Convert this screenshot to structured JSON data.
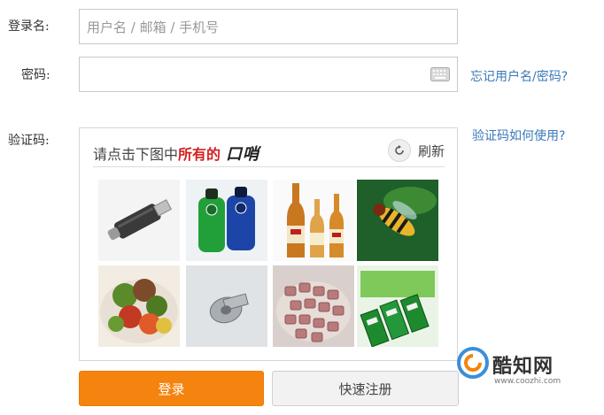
{
  "form": {
    "username_label": "登录名:",
    "username_placeholder": "用户名 / 邮箱 / 手机号",
    "password_label": "密码:",
    "forgot_link": "忘记用户名/密码?",
    "captcha_label": "验证码:",
    "captcha_help_link": "验证码如何使用?"
  },
  "captcha": {
    "prompt_plain": "请点击下图中",
    "prompt_highlight": "所有的",
    "target_word": "口哨",
    "refresh_label": "刷新",
    "tiles": [
      {
        "name": "usb-drive-image",
        "row": 1,
        "col": 1
      },
      {
        "name": "colored-bottles-image",
        "row": 1,
        "col": 2
      },
      {
        "name": "beer-bottles-image",
        "row": 1,
        "col": 3
      },
      {
        "name": "hoverfly-insect-image",
        "row": 1,
        "col": 4
      },
      {
        "name": "salad-image",
        "row": 2,
        "col": 1
      },
      {
        "name": "whistle-image",
        "row": 2,
        "col": 2
      },
      {
        "name": "candy-sugar-image",
        "row": 2,
        "col": 3
      },
      {
        "name": "green-whistles-image",
        "row": 2,
        "col": 4
      }
    ]
  },
  "buttons": {
    "login_label": "登录",
    "register_label": "快速注册"
  },
  "watermark": {
    "brand": "酷知网",
    "url": "www.coozhi.com"
  },
  "colors": {
    "accent_orange": "#f5830f",
    "link_blue": "#3a78b9",
    "highlight_red": "#d41f1f"
  }
}
